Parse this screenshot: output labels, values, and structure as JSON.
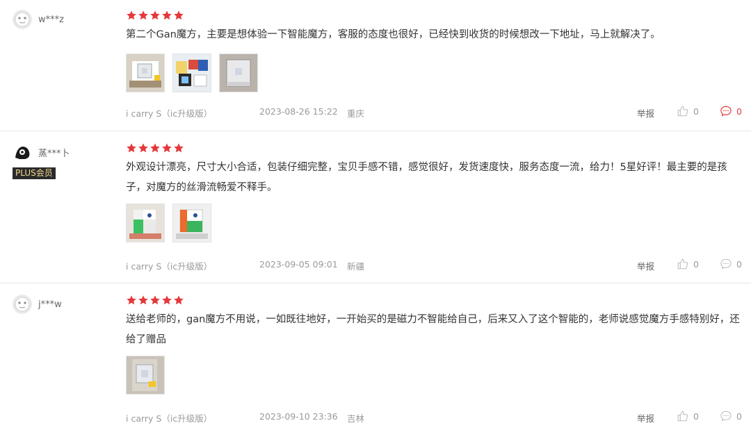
{
  "colors": {
    "star": "#e4393c",
    "comment_active": "#e4393c",
    "plus_bg": "#2b2b2b",
    "plus_text": "#f0d792"
  },
  "labels": {
    "report": "举报"
  },
  "reviews": [
    {
      "user": "w***z",
      "plus": "",
      "rating": 5,
      "text": "第二个Gan魔方，主要是想体验一下智能魔方，客服的态度也很好，已经快到收货的时候想改一下地址，马上就解决了。",
      "spec": "i carry S（ic升级版）",
      "time": "2023-08-26 15:22",
      "location": "重庆",
      "likes": "0",
      "comments": "0"
    },
    {
      "user": "蒸***卜",
      "plus": "PLUS会员",
      "rating": 5,
      "text": "外观设计漂亮，尺寸大小合适，包装仔细完整，宝贝手感不错，感觉很好，发货速度快，服务态度一流，给力！5星好评！最主要的是孩子，对魔方的丝滑流畅爱不释手。",
      "spec": "i carry S（ic升级版）",
      "time": "2023-09-05 09:01",
      "location": "新疆",
      "likes": "0",
      "comments": "0"
    },
    {
      "user": "j***w",
      "plus": "",
      "rating": 5,
      "text": "送给老师的，gan魔方不用说，一如既往地好，一开始买的是磁力不智能给自己，后来又入了这个智能的，老师说感觉魔方手感特别好，还给了赠品",
      "spec": "i carry S（ic升级版）",
      "time": "2023-09-10 23:36",
      "location": "吉林",
      "likes": "0",
      "comments": "0"
    }
  ]
}
